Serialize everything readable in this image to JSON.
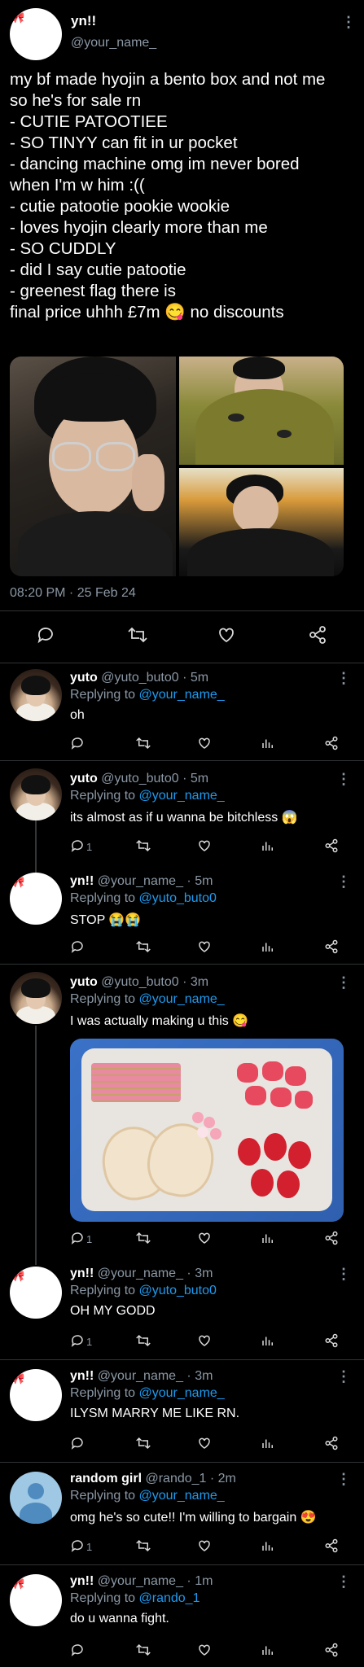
{
  "main_tweet": {
    "author_name": "yn!!",
    "author_handle": "@your_name_",
    "text": "my bf made hyojin a bento box and not me\nso he's for sale rn\n- CUTIE PATOOTIEE\n- SO TINYY can fit in ur pocket\n- dancing machine omg im never bored\nwhen I'm w him :((\n- cutie patootie pookie wookie\n- loves hyojin clearly more than me\n- SO CUDDLY\n- did I say cutie patootie\n- greenest flag there is\nfinal price uhhh £7m 😋 no discounts",
    "timestamp": "08:20 PM · 25 Feb 24",
    "avatar_decoration": "🎀"
  },
  "replies": [
    {
      "name": "yuto",
      "handle": "@yuto_buto0",
      "time": "5m",
      "replying_to": "@your_name_",
      "text": "oh",
      "reply_count": "",
      "avatar": "yuto"
    },
    {
      "name": "yuto",
      "handle": "@yuto_buto0",
      "time": "5m",
      "replying_to": "@your_name_",
      "text": "its almost as if u wanna be bitchless 😱",
      "reply_count": "1",
      "avatar": "yuto"
    },
    {
      "name": "yn!!",
      "handle": "@your_name_",
      "time": "5m",
      "replying_to": "@yuto_buto0",
      "text": "STOP 😭😭",
      "reply_count": "",
      "avatar": "blank"
    },
    {
      "name": "yuto",
      "handle": "@yuto_buto0",
      "time": "3m",
      "replying_to": "@your_name_",
      "text": "I was actually making u this 😋",
      "reply_count": "1",
      "avatar": "yuto"
    },
    {
      "name": "yn!!",
      "handle": "@your_name_",
      "time": "3m",
      "replying_to": "@yuto_buto0",
      "text": "OH MY GODD",
      "reply_count": "1",
      "avatar": "blank"
    },
    {
      "name": "yn!!",
      "handle": "@your_name_",
      "time": "3m",
      "replying_to": "@your_name_",
      "text": "ILYSM MARRY ME LIKE RN.",
      "reply_count": "",
      "avatar": "blank"
    },
    {
      "name": "random girl",
      "handle": "@rando_1",
      "time": "2m",
      "replying_to": "@your_name_",
      "text": "omg he's so cute!! I'm willing to bargain 😍",
      "reply_count": "1",
      "avatar": "rando"
    },
    {
      "name": "yn!!",
      "handle": "@your_name_",
      "time": "1m",
      "replying_to": "@rando_1",
      "text": "do u wanna fight.",
      "reply_count": "",
      "avatar": "blank"
    }
  ],
  "labels": {
    "separator": " · ",
    "replying_prefix": "Replying to "
  },
  "icons": {
    "more": "more-vertical-icon",
    "reply": "reply-icon",
    "retweet": "retweet-icon",
    "like": "heart-icon",
    "views": "views-icon",
    "share": "share-icon"
  },
  "colors": {
    "background": "#000000",
    "text": "#e7e9ea",
    "secondary": "#8b98a5",
    "link": "#1d9bf0",
    "divider": "#2f3336"
  }
}
